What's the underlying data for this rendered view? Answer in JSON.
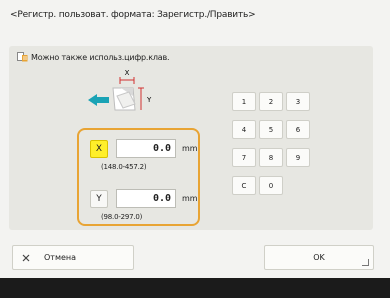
{
  "screen": {
    "title": "<Регистр. пользоват. формата: Зарегистр./Править>",
    "hint": "Можно также использ.цифр.клав."
  },
  "diagram": {
    "x_label": "X",
    "y_label": "Y"
  },
  "fields": {
    "x": {
      "axis_label": "X",
      "value": "0.0",
      "unit": "mm",
      "range": "(148.0-457.2)"
    },
    "y": {
      "axis_label": "Y",
      "value": "0.0",
      "unit": "mm",
      "range": "(98.0-297.0)"
    }
  },
  "keypad": {
    "keys": [
      "1",
      "2",
      "3",
      "4",
      "5",
      "6",
      "7",
      "8",
      "9",
      "C",
      "0"
    ]
  },
  "buttons": {
    "cancel_label": "Отмена",
    "cancel_icon": "close-icon",
    "ok_label": "OK"
  },
  "colors": {
    "accent_orange": "#e8a434",
    "selected_yellow": "#ffef2a",
    "arrow_teal": "#1aa3b5",
    "indicator_red": "#d23030",
    "footer": "#1b1b1b"
  }
}
